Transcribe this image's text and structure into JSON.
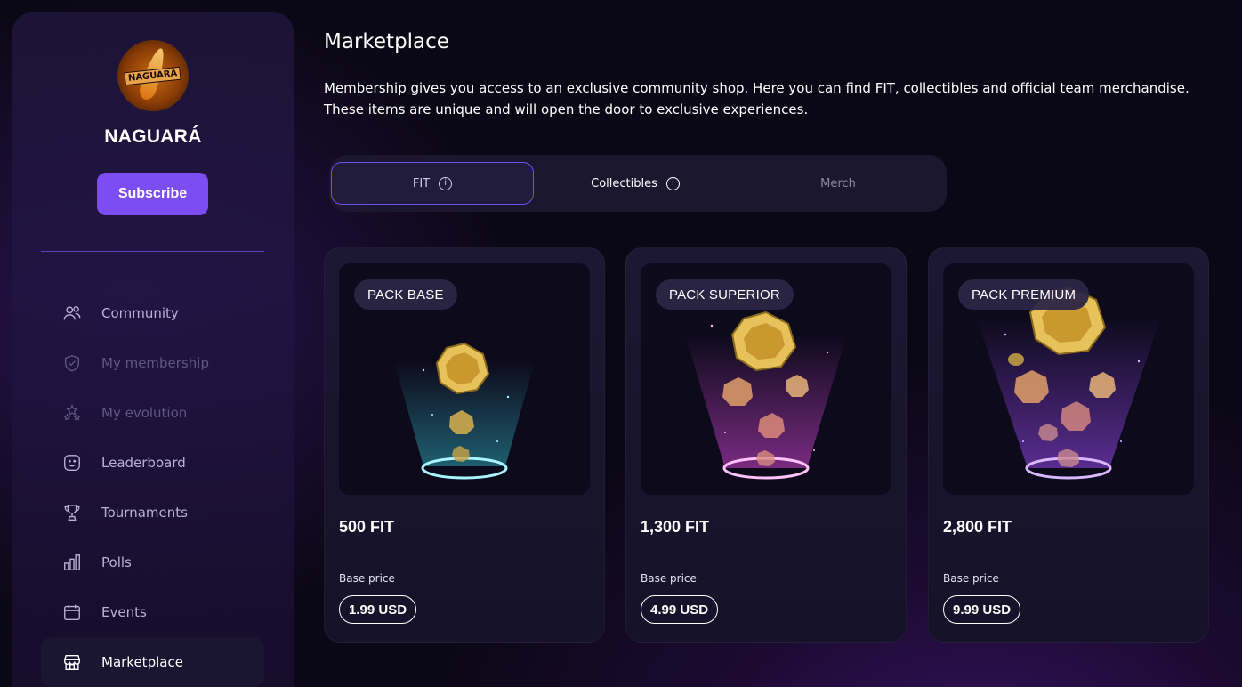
{
  "sidebar": {
    "team_name": "NAGUARÁ",
    "avatar_text": "NAGUARA",
    "subscribe_label": "Subscribe",
    "items": [
      {
        "label": "Community",
        "icon": "community-icon",
        "state": "normal"
      },
      {
        "label": "My membership",
        "icon": "shield-icon",
        "state": "disabled"
      },
      {
        "label": "My evolution",
        "icon": "stars-icon",
        "state": "disabled"
      },
      {
        "label": "Leaderboard",
        "icon": "smiley-icon",
        "state": "normal"
      },
      {
        "label": "Tournaments",
        "icon": "trophy-icon",
        "state": "normal"
      },
      {
        "label": "Polls",
        "icon": "bar-chart-icon",
        "state": "normal"
      },
      {
        "label": "Events",
        "icon": "calendar-icon",
        "state": "normal"
      },
      {
        "label": "Marketplace",
        "icon": "store-icon",
        "state": "active"
      }
    ]
  },
  "main": {
    "title": "Marketplace",
    "description": "Membership gives you access to an exclusive community shop. Here you can find FIT, collectibles and official team merchandise. These items are unique and will open the door to exclusive experiences.",
    "tabs": [
      {
        "label": "FIT",
        "info": "i",
        "state": "active"
      },
      {
        "label": "Collectibles",
        "info": "i",
        "state": "normal"
      },
      {
        "label": "Merch",
        "state": "muted"
      }
    ],
    "cards": [
      {
        "pack": "PACK BASE",
        "amount": "500 FIT",
        "base_label": "Base price",
        "price": "1.99 USD",
        "glow": "#38d6e6"
      },
      {
        "pack": "PACK SUPERIOR",
        "amount": "1,300 FIT",
        "base_label": "Base price",
        "price": "4.99 USD",
        "glow": "#e04adf"
      },
      {
        "pack": "PACK PREMIUM",
        "amount": "2,800 FIT",
        "base_label": "Base price",
        "price": "9.99 USD",
        "glow": "#9b4af2"
      }
    ]
  },
  "colors": {
    "accent": "#7b4df3",
    "background": "#0b0816",
    "coin_gold": "#e7c25a"
  }
}
